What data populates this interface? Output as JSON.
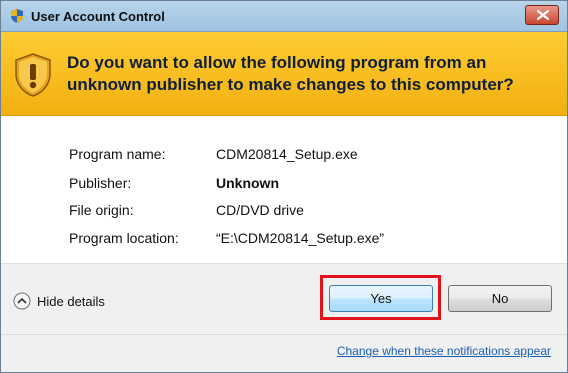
{
  "window": {
    "title": "User Account Control"
  },
  "banner": {
    "line1": "Do you want to allow the following program from an",
    "line2": "unknown publisher to make changes to this computer?"
  },
  "details": [
    {
      "label": "Program name:",
      "value": "CDM20814_Setup.exe",
      "bold": false
    },
    {
      "label": "Publisher:",
      "value": "Unknown",
      "bold": true
    },
    {
      "label": "File origin:",
      "value": "CD/DVD drive",
      "bold": false
    },
    {
      "label": "Program location:",
      "value": "“E:\\CDM20814_Setup.exe”",
      "bold": false
    }
  ],
  "footer": {
    "hide_details_label": "Hide details",
    "yes_label": "Yes",
    "no_label": "No",
    "link_text": "Change when these notifications appear"
  },
  "colors": {
    "banner": "#ffcc33",
    "highlight": "#e3121b",
    "link": "#1a5fb4"
  }
}
